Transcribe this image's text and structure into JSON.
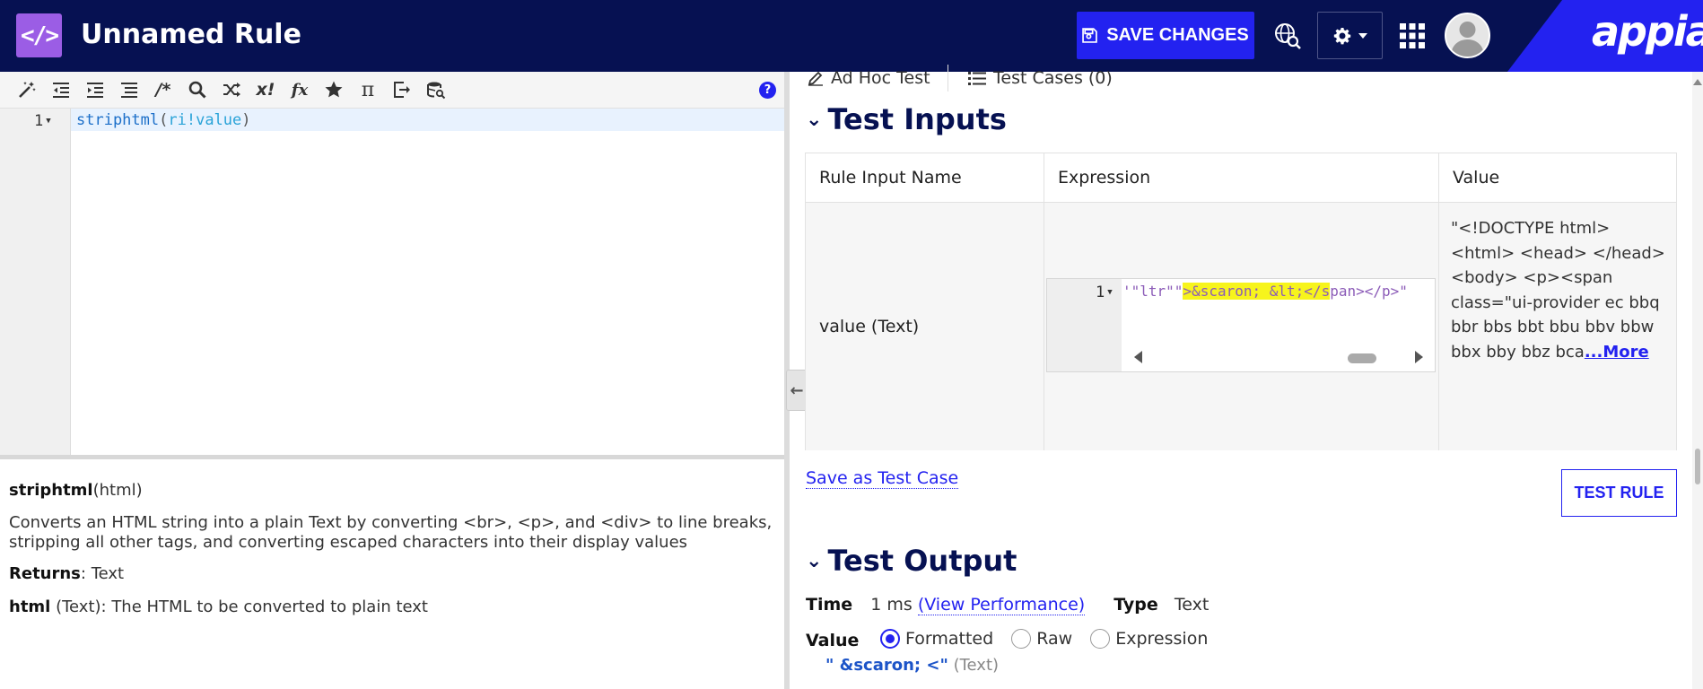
{
  "header": {
    "icon_glyph": "</>",
    "title": "Unnamed Rule",
    "save_label": "SAVE CHANGES",
    "brand": "appian",
    "colors": {
      "nav_bg": "#061152",
      "accent": "#2322f0",
      "rule_icon": "#9b5de5"
    }
  },
  "toolbar": {
    "help_glyph": "?",
    "icons": [
      "magic-wand-icon",
      "outdent-icon",
      "indent-icon",
      "format-list-icon",
      "comment-icon",
      "search-icon",
      "shuffle-icon",
      "variable-icon",
      "function-icon",
      "star-icon",
      "pi-icon",
      "export-icon",
      "database-search-icon"
    ]
  },
  "editor": {
    "line_number": "1",
    "code_fn": "striphtml",
    "code_open": "(",
    "code_arg": "ri!value",
    "code_close": ")"
  },
  "docs": {
    "fn_name": "striphtml",
    "fn_params": "(html)",
    "description": "Converts an HTML string into a plain Text by converting <br>, <p>, and <div> to line breaks, stripping all other tags, and converting escaped characters into their display values",
    "returns_label": "Returns",
    "returns_value": ": Text",
    "param_name": "html",
    "param_desc": " (Text): The HTML to be converted to plain text"
  },
  "tabs": {
    "adhoc": "Ad Hoc Test",
    "cases": "Test Cases (0)"
  },
  "test_inputs": {
    "heading": "Test Inputs",
    "columns": [
      "Rule Input Name",
      "Expression",
      "Value"
    ],
    "row": {
      "name": "value (Text)",
      "expr_line": "1",
      "expr_pre": "'\"ltr\"\"",
      "expr_highlight": ">&scaron; &lt;</s",
      "expr_post": "pan></p>\"",
      "value_text": "\"<!DOCTYPE html> <html> <head> </head> <body> <p><span class=\"ui-provider ec bbq bbr bbs bbt bbu bbv bbw bbx bby bbz bca",
      "value_more": "...More"
    },
    "save_case": "Save as Test Case",
    "test_rule": "TEST RULE"
  },
  "test_output": {
    "heading": "Test Output",
    "time_label": "Time",
    "time_value": "1 ms",
    "perf_link": "(View Performance)",
    "type_label": "Type",
    "type_value": "Text",
    "value_label": "Value",
    "modes": [
      "Formatted",
      "Raw",
      "Expression"
    ],
    "selected_mode": "Formatted",
    "result_string": "\" &scaron; <\"",
    "result_type": "(Text)"
  }
}
